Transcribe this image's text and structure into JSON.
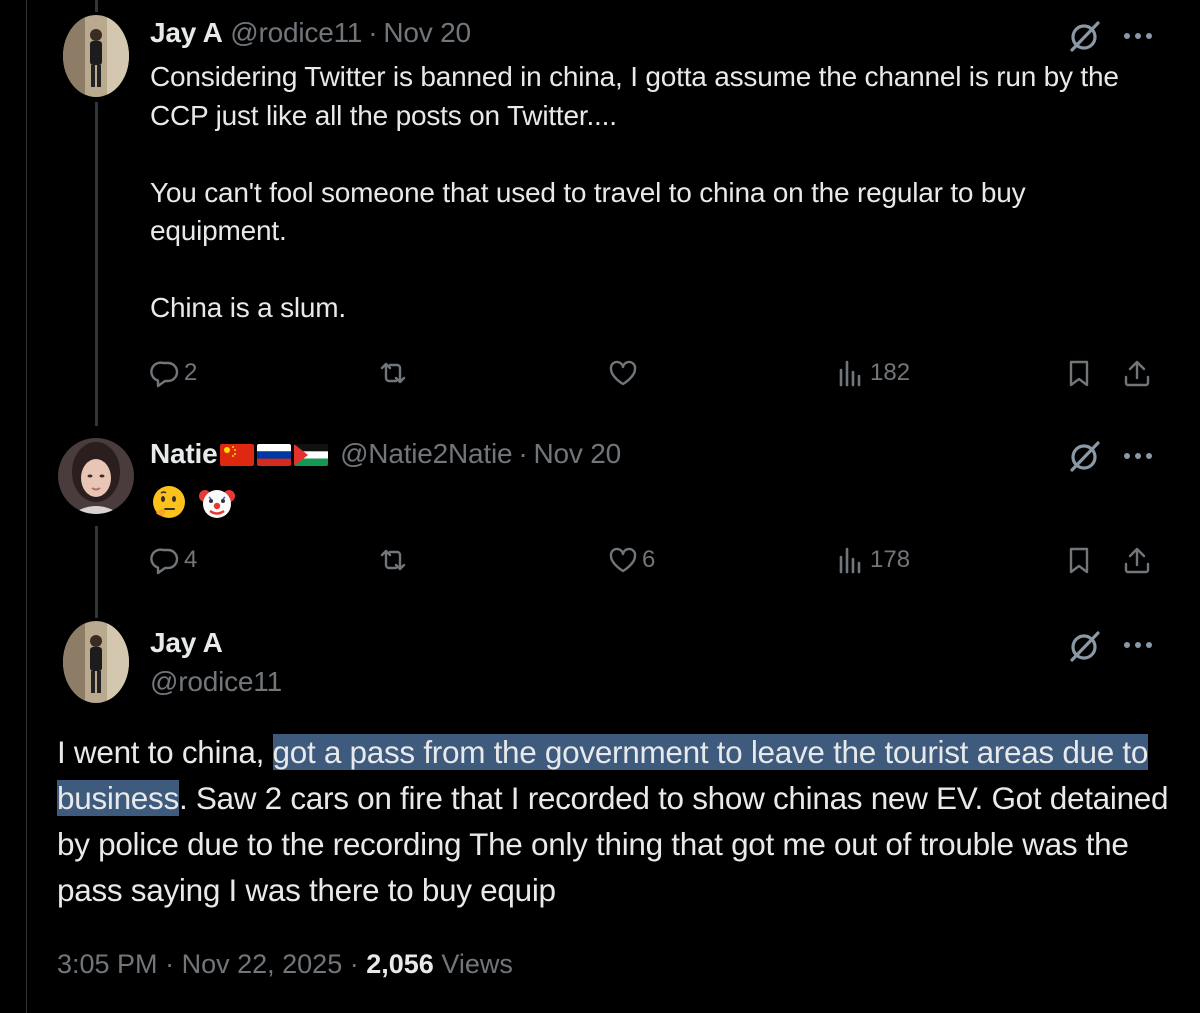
{
  "reply1": {
    "name": "Jay A",
    "handle": "@rodice11",
    "date": "Nov 20",
    "paragraphs": [
      "Considering Twitter is banned in china, I gotta assume the channel is run by the CCP just like all the posts on Twitter....",
      "You can't fool someone that used to travel to china on the regular to buy equipment.",
      "China is a slum."
    ],
    "replies": "2",
    "views": "182"
  },
  "reply2": {
    "name": "Natie",
    "flags": [
      "china-flag",
      "russia-flag",
      "palestine-flag"
    ],
    "handle": "@Natie2Natie",
    "date": "Nov 20",
    "emojis": [
      "thinking-face-emoji",
      "clown-face-emoji"
    ],
    "replies": "4",
    "likes": "6",
    "views": "178"
  },
  "main": {
    "name": "Jay A",
    "handle": "@rodice11",
    "text_before": "I went to china, ",
    "text_highlight": "got a pass from the government to leave the tourist areas due to business",
    "text_after": ". Saw 2 cars on fire that I recorded to show chinas new EV. Got detained by police due to the recording The only thing that got me out of trouble was the pass saying I was there to buy equip",
    "time": "3:05 PM",
    "date": "Nov 22, 2025",
    "views_count": "2,056",
    "views_label": "Views",
    "separator": "·"
  },
  "colors": {
    "background": "#000000",
    "text": "#e7e9ea",
    "muted": "#71767b",
    "highlight": "#3e5a7c",
    "thread_line": "#333639"
  }
}
